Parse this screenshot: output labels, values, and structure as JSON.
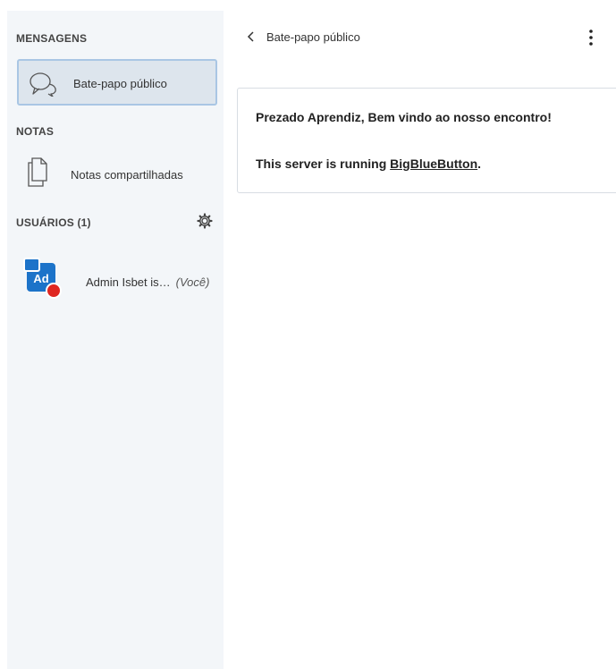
{
  "sidebar": {
    "messages_title": "MENSAGENS",
    "public_chat_label": "Bate-papo público",
    "notes_title": "NOTAS",
    "shared_notes_label": "Notas compartilhadas",
    "users_title": "USUÁRIOS (1)",
    "users": [
      {
        "initials": "Ad",
        "name": "Admin Isbet is…",
        "you_label": "(Você)"
      }
    ]
  },
  "chat": {
    "title": "Bate-papo público",
    "welcome_message": "Prezado Aprendiz, Bem vindo ao nosso encontro!",
    "server_prefix": "This server is running ",
    "server_link": "BigBlueButton",
    "server_suffix": "."
  },
  "icons": {
    "chat": "chat-bubbles-icon",
    "notes": "notes-icon",
    "settings": "gear-icon",
    "back": "chevron-left-icon",
    "more": "more-vertical-icon",
    "presenter": "presenter-icon",
    "status": "status-away-icon"
  },
  "colors": {
    "sidebar_bg": "#f3f6f9",
    "selected_item_bg": "#dde5ed",
    "selected_item_border": "#a9c6e4",
    "avatar_bg": "#1c73c9",
    "status_red": "#df2721"
  }
}
